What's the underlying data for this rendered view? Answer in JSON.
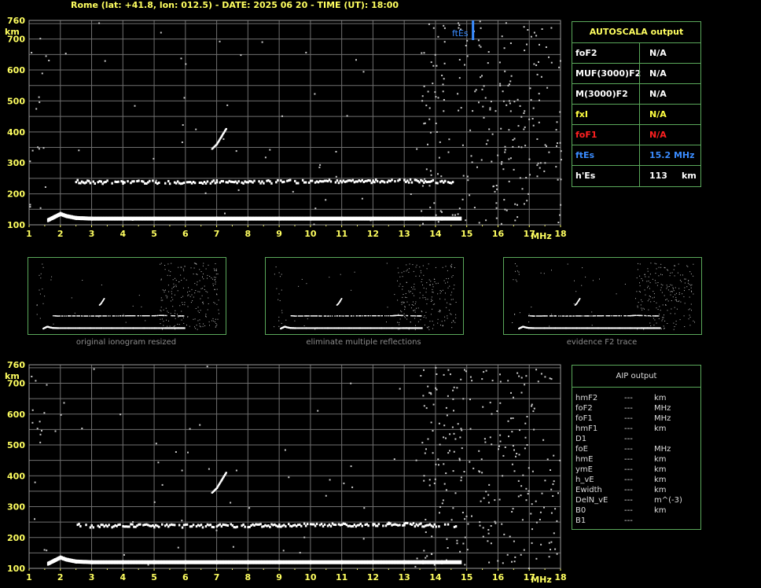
{
  "header": {
    "station": "Rome (lat: +41.8, lon: 012.5)",
    "date": "DATE: 2025 06 20",
    "time": "TIME (UT): 18:00"
  },
  "chart_data": [
    {
      "type": "scatter",
      "title": "",
      "xlabel": "MHz",
      "ylabel": "km",
      "xlim": [
        1,
        18
      ],
      "ylim": [
        100,
        760
      ],
      "x_ticks": [
        "1",
        "2",
        "3",
        "4",
        "5",
        "6",
        "7",
        "8",
        "9",
        "10",
        "11",
        "12",
        "13",
        "14",
        "15",
        "16",
        "17",
        "18"
      ],
      "y_ticks": [
        "100",
        "200",
        "300",
        "400",
        "500",
        "600",
        "700",
        "760"
      ],
      "grid": true,
      "series": [
        {
          "role": "E-layer trace",
          "x": [
            1.6,
            1.8,
            2.0,
            2.2,
            2.5,
            3.0,
            4.0,
            5.0,
            6.0,
            7.0,
            8.0,
            9.0,
            10.0,
            11.0,
            12.0,
            13.0,
            13.6,
            14.2,
            14.8
          ],
          "y": [
            115,
            125,
            135,
            128,
            122,
            120,
            120,
            120,
            120,
            120,
            120,
            120,
            120,
            120,
            120,
            120,
            120,
            120,
            120
          ]
        },
        {
          "role": "second-hop trace",
          "x": [
            2.5,
            3.0,
            4.0,
            5.0,
            6.0,
            7.0,
            8.0,
            9.0,
            10.0,
            11.0,
            12.0,
            12.5,
            13.0,
            14.3,
            14.7
          ],
          "y": [
            240,
            237,
            238,
            238,
            237,
            238,
            238,
            239,
            240,
            240,
            240,
            243,
            242,
            238,
            238
          ]
        },
        {
          "role": "oblique trace",
          "x": [
            6.85,
            7.0,
            7.15,
            7.3
          ],
          "y": [
            345,
            360,
            385,
            410
          ]
        }
      ],
      "markers": [
        {
          "label": "ftEs",
          "x": 15.2,
          "color": "#3a8cff"
        }
      ]
    },
    {
      "type": "scatter",
      "title": "",
      "xlabel": "MHz",
      "ylabel": "km",
      "xlim": [
        1,
        18
      ],
      "ylim": [
        100,
        760
      ],
      "x_ticks": [
        "1",
        "2",
        "3",
        "4",
        "5",
        "6",
        "7",
        "8",
        "9",
        "10",
        "11",
        "12",
        "13",
        "14",
        "15",
        "16",
        "17",
        "18"
      ],
      "y_ticks": [
        "100",
        "200",
        "300",
        "400",
        "500",
        "600",
        "700",
        "760"
      ],
      "grid": true,
      "series": [
        {
          "role": "E-layer trace",
          "x": [
            1.6,
            1.8,
            2.0,
            2.2,
            2.5,
            3.0,
            4.0,
            5.0,
            6.0,
            7.0,
            8.0,
            9.0,
            10.0,
            11.0,
            12.0,
            13.0,
            13.6,
            14.2,
            14.8
          ],
          "y": [
            115,
            125,
            135,
            128,
            122,
            120,
            120,
            120,
            120,
            120,
            120,
            120,
            120,
            120,
            120,
            120,
            120,
            120,
            120
          ]
        },
        {
          "role": "second-hop trace",
          "x": [
            2.5,
            3.0,
            4.0,
            5.0,
            6.0,
            7.0,
            8.0,
            9.0,
            10.0,
            11.0,
            12.0,
            12.5,
            13.0,
            14.3,
            14.7
          ],
          "y": [
            240,
            237,
            238,
            238,
            237,
            238,
            238,
            239,
            240,
            240,
            240,
            243,
            242,
            238,
            238
          ]
        },
        {
          "role": "oblique trace",
          "x": [
            6.85,
            7.0,
            7.15,
            7.3
          ],
          "y": [
            345,
            360,
            385,
            410
          ]
        }
      ]
    }
  ],
  "autoscala": {
    "title": "AUTOSCALA output",
    "rows": [
      {
        "label": "foF2",
        "value": "N/A",
        "color": "#ffffff"
      },
      {
        "label": "MUF(3000)F2",
        "value": "N/A",
        "color": "#ffffff"
      },
      {
        "label": "M(3000)F2",
        "value": "N/A",
        "color": "#ffffff"
      },
      {
        "label": "fxI",
        "value": "N/A",
        "color": "#ffff40"
      },
      {
        "label": "foF1",
        "value": "N/A",
        "color": "#ff2020"
      },
      {
        "label": "ftEs",
        "value": "15.2 MHz",
        "color": "#3a8cff"
      },
      {
        "label": "h'Es",
        "value": "113",
        "unit": "km",
        "color": "#ffffff"
      }
    ]
  },
  "thumbnails": [
    {
      "caption": "original ionogram resized"
    },
    {
      "caption": "eliminate multiple reflections"
    },
    {
      "caption": "evidence F2 trace"
    }
  ],
  "aip": {
    "title": "AIP output",
    "rows": [
      {
        "label": "hmF2",
        "value": "---",
        "unit": "km"
      },
      {
        "label": "foF2",
        "value": "---",
        "unit": "MHz"
      },
      {
        "label": "foF1",
        "value": "---",
        "unit": "MHz"
      },
      {
        "label": "hmF1",
        "value": "---",
        "unit": "km"
      },
      {
        "label": "D1",
        "value": "---",
        "unit": ""
      },
      {
        "label": "foE",
        "value": "---",
        "unit": "MHz"
      },
      {
        "label": "hmE",
        "value": "---",
        "unit": "km"
      },
      {
        "label": "ymE",
        "value": "---",
        "unit": "km"
      },
      {
        "label": "h_vE",
        "value": "---",
        "unit": "km"
      },
      {
        "label": "Ewidth",
        "value": "---",
        "unit": "km"
      },
      {
        "label": "DelN_vE",
        "value": "---",
        "unit": "m^(-3)"
      },
      {
        "label": "B0",
        "value": "---",
        "unit": "km"
      },
      {
        "label": "B1",
        "value": "---",
        "unit": ""
      }
    ]
  },
  "colors": {
    "header": "#ffff60",
    "axis_labels": "#ffff60",
    "grid": "#6f6f6f",
    "frame": "#5aa85a",
    "trace": "#ffffff",
    "noise": "#c8c8c8",
    "ftEs": "#3a8cff"
  }
}
